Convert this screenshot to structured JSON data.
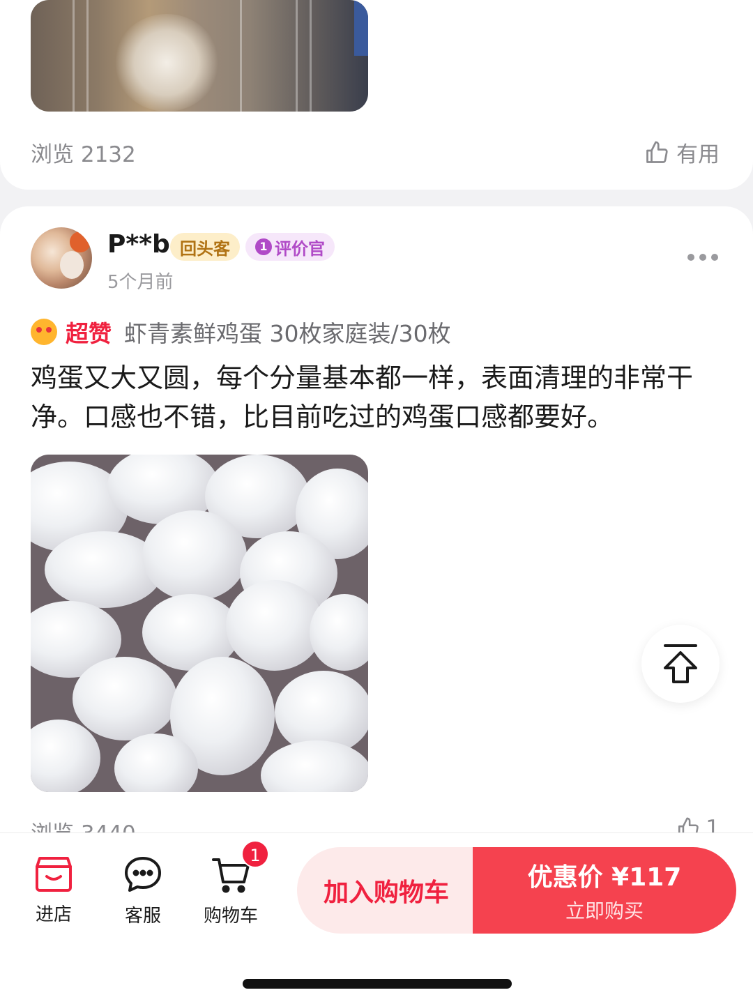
{
  "previous_review": {
    "views": "浏览 2132",
    "useful": "有用"
  },
  "review": {
    "username": "P**b",
    "tags": {
      "returning": "回头客",
      "reviewer_badge": "1",
      "reviewer": "评价官"
    },
    "time": "5个月前",
    "rating_label": "超赞",
    "product": "虾青素鲜鸡蛋 30枚家庭装/30枚",
    "text": "鸡蛋又大又圆，每个分量基本都一样，表面清理的非常干净。口感也不错，比目前吃过的鸡蛋口感都要好。",
    "views": "浏览 3440",
    "useful_count": "1"
  },
  "bottom_bar": {
    "store": "进店",
    "service": "客服",
    "cart": "购物车",
    "cart_badge": "1",
    "add_to_cart": "加入购物车",
    "price": "优惠价 ¥117",
    "buy_now": "立即购买"
  },
  "colors": {
    "accent_red": "#f0213f",
    "buy_button": "#f5424f",
    "add_button_bg": "#fdeaea",
    "tag_returning": "#b07213",
    "tag_reviewer": "#b04ac7"
  },
  "icons": [
    "thumbs-up-icon",
    "more-icon",
    "back-to-top-icon",
    "store-icon",
    "chat-icon",
    "cart-icon",
    "rating-emoji-icon"
  ]
}
